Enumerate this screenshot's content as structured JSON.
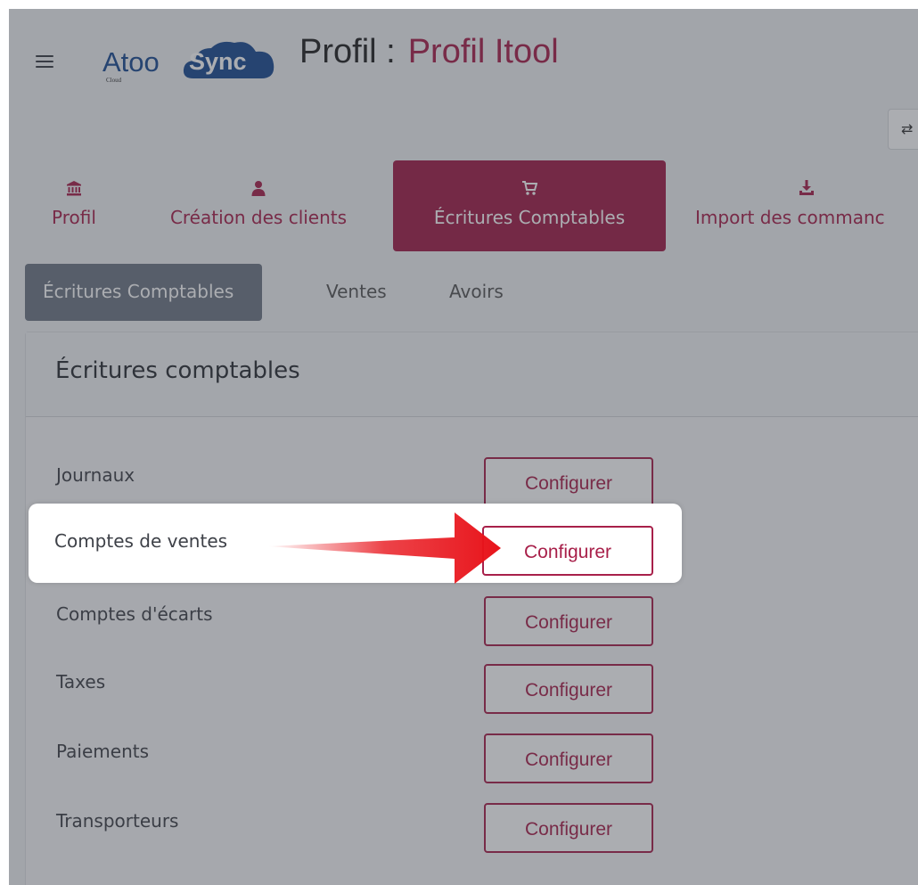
{
  "header": {
    "logo_atoo": "Atoo",
    "logo_sync": "Sync",
    "logo_cloud": "Cloud",
    "title_label": "Profil :",
    "profile_name": "Profil Itool"
  },
  "main_tabs": [
    {
      "label": "Profil",
      "icon": "bank-icon"
    },
    {
      "label": "Création des clients",
      "icon": "user-icon"
    },
    {
      "label": "Écritures Comptables",
      "icon": "cart-icon",
      "active": true
    },
    {
      "label": "Import des commanc",
      "icon": "download-icon"
    }
  ],
  "sub_tabs": [
    {
      "label": "Écritures Comptables",
      "active": true
    },
    {
      "label": "Ventes"
    },
    {
      "label": "Avoirs"
    }
  ],
  "card": {
    "title": "Écritures comptables",
    "rows": [
      {
        "label": "Journaux",
        "button": "Configurer"
      },
      {
        "label": "Comptes de ventes",
        "button": "Configurer",
        "highlighted": true
      },
      {
        "label": "Comptes d'écarts",
        "button": "Configurer"
      },
      {
        "label": "Taxes",
        "button": "Configurer"
      },
      {
        "label": "Paiements",
        "button": "Configurer"
      },
      {
        "label": "Transporteurs",
        "button": "Configurer"
      }
    ]
  },
  "colors": {
    "accent": "#a8204a",
    "active_tab_bg": "#a01d48",
    "subtab_active_bg": "#6f7785",
    "logo_blue": "#1b4a91",
    "arrow_red": "#e8141b"
  }
}
